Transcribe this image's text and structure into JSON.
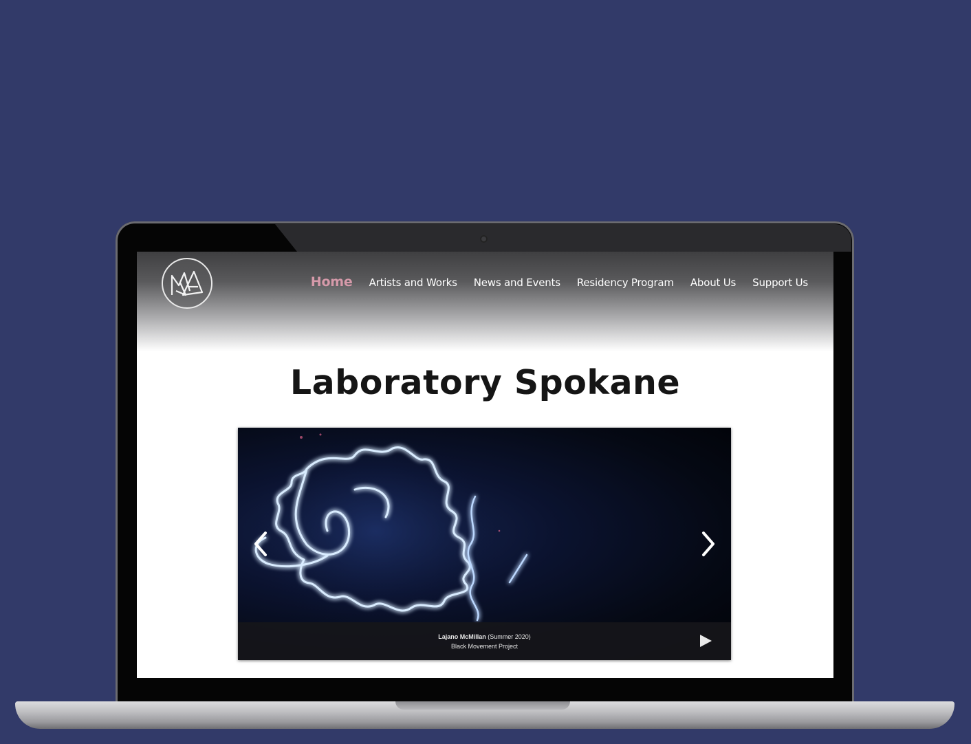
{
  "site": {
    "title": "Laboratory Spokane",
    "logo_icon": "laboratory-logo-icon",
    "nav": [
      {
        "label": "Home",
        "active": true
      },
      {
        "label": "Artists and Works",
        "active": false
      },
      {
        "label": "News and Events",
        "active": false
      },
      {
        "label": "Residency Program",
        "active": false
      },
      {
        "label": "About Us",
        "active": false
      },
      {
        "label": "Support Us",
        "active": false
      }
    ]
  },
  "carousel": {
    "artist": "Lajano McMillan",
    "term": "(Summer 2020)",
    "project": "Black Movement Project",
    "prev_icon": "chevron-left-icon",
    "next_icon": "chevron-right-icon",
    "play_icon": "play-icon"
  },
  "colors": {
    "background": "#323a69",
    "nav_active": "#d69aaa",
    "title": "#151515"
  }
}
